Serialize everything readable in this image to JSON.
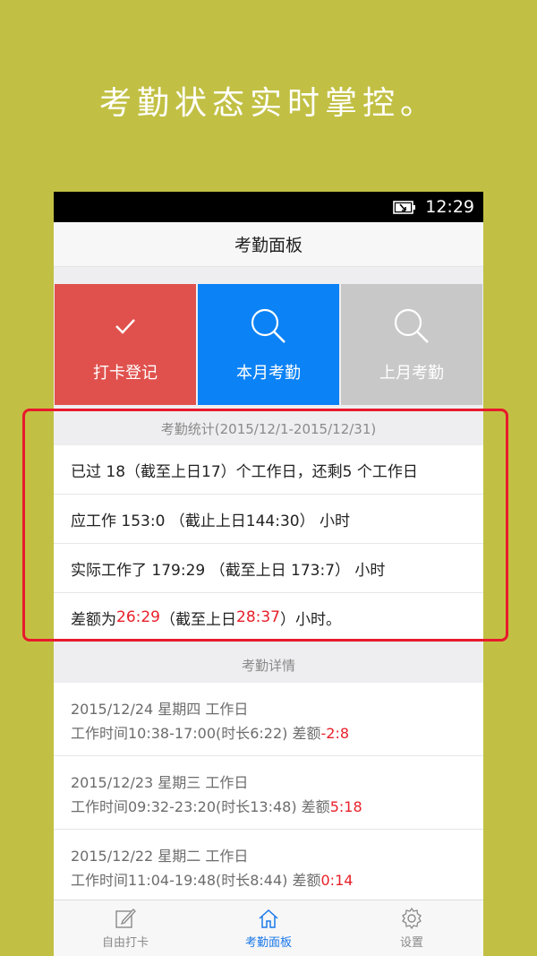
{
  "headline": "考勤状态实时掌控。",
  "status_bar": {
    "time": "12:29",
    "battery_icon": "battery-charging-icon"
  },
  "nav": {
    "title": "考勤面板"
  },
  "tiles": [
    {
      "label": "打卡登记",
      "icon": "checkmark-icon",
      "color": "#e0514d"
    },
    {
      "label": "本月考勤",
      "icon": "search-icon",
      "color": "#0b82f5"
    },
    {
      "label": "上月考勤",
      "icon": "search-icon",
      "color": "#c8c8c8"
    }
  ],
  "stats": {
    "header": "考勤统计(2015/12/1-2015/12/31)",
    "row1": "已过 18（截至上日17）个工作日，还剩5 个工作日",
    "row2": "应工作 153:0 （截止上日144:30） 小时",
    "row3": "实际工作了 179:29 （截至上日 173:7） 小时",
    "row4": {
      "prefix": "差额为 ",
      "value": "26:29",
      "middle": " （截至上日",
      "prev_value": "28:37",
      "suffix": "）小时。"
    }
  },
  "details": {
    "header": "考勤详情",
    "items": [
      {
        "date_line": "2015/12/24 星期四 工作日",
        "time_line": "工作时间10:38-17:00(时长6:22) 差额",
        "diff": "-2:8"
      },
      {
        "date_line": "2015/12/23 星期三 工作日",
        "time_line": "工作时间09:32-23:20(时长13:48) 差额",
        "diff": "5:18"
      },
      {
        "date_line": "2015/12/22 星期二 工作日",
        "time_line": "工作时间11:04-19:48(时长8:44) 差额",
        "diff": "0:14"
      }
    ]
  },
  "tabbar": {
    "tabs": [
      {
        "label": "自由打卡",
        "icon": "edit-icon",
        "active": false
      },
      {
        "label": "考勤面板",
        "icon": "home-icon",
        "active": true
      },
      {
        "label": "设置",
        "icon": "gear-icon",
        "active": false
      }
    ]
  },
  "colors": {
    "background": "#c2c044",
    "accent_blue": "#0b82f5",
    "alert_red": "#e8202a",
    "highlight_box": "#e8192c"
  }
}
